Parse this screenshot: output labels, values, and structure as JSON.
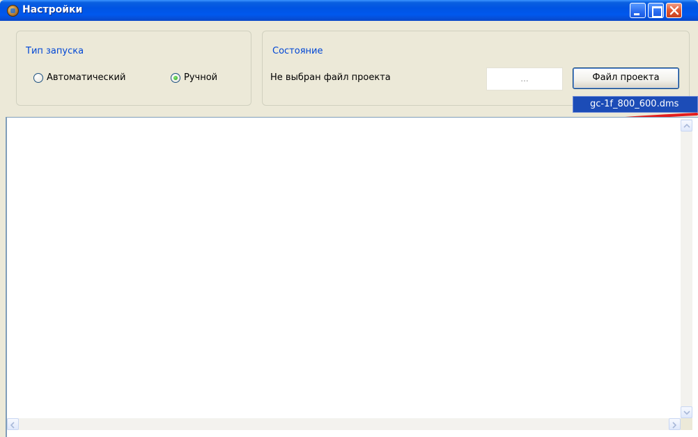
{
  "window": {
    "title": "Настройки"
  },
  "launch_group": {
    "legend": "Тип запуска",
    "options": [
      {
        "label": "Автоматический",
        "checked": false
      },
      {
        "label": "Ручной",
        "checked": true
      }
    ]
  },
  "state_group": {
    "legend": "Состояние",
    "status": "Не выбран файл проекта",
    "path_placeholder": "...",
    "file_button": "Файл проекта"
  },
  "dropdown": {
    "item": "gc-1f_800_600.dms"
  },
  "icons": {
    "app": "app-icon",
    "minimize": "minimize-icon",
    "maximize": "maximize-icon",
    "close": "close-icon"
  },
  "colors": {
    "titlebar": "#0054e3",
    "legend_text": "#0046d5",
    "dropdown_bg": "#1c4cb7",
    "annotation": "#e41d1d"
  }
}
